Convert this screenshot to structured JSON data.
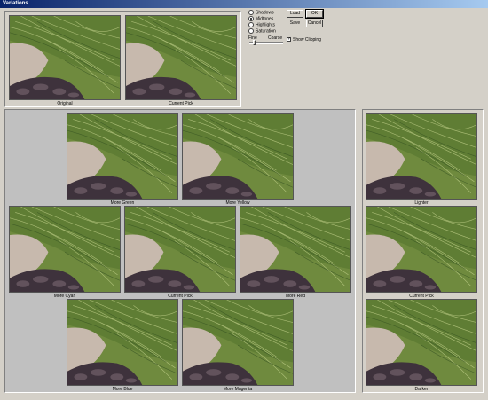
{
  "window": {
    "title": "Variations"
  },
  "top_previews": {
    "original": "Original",
    "current_pick": "Current Pick"
  },
  "tone_options": [
    {
      "label": "Shadows",
      "selected": false
    },
    {
      "label": "Midtones",
      "selected": true
    },
    {
      "label": "Highlights",
      "selected": false
    },
    {
      "label": "Saturation",
      "selected": false
    }
  ],
  "slider": {
    "fine": "Fine",
    "coarse": "Coarse"
  },
  "show_clipping": {
    "label": "Show Clipping",
    "checked": true,
    "mark": "✓"
  },
  "buttons": {
    "load": "Load",
    "ok": "OK",
    "save": "Save",
    "cancel": "Cancel"
  },
  "variations": {
    "more_green": "More Green",
    "more_yellow": "More Yellow",
    "more_cyan": "More Cyan",
    "current_pick": "Current Pick",
    "more_red": "More Red",
    "more_blue": "More Blue",
    "more_magenta": "More Magenta"
  },
  "brightness": {
    "lighter": "Lighter",
    "current_pick": "Current Pick",
    "darker": "Darker"
  }
}
